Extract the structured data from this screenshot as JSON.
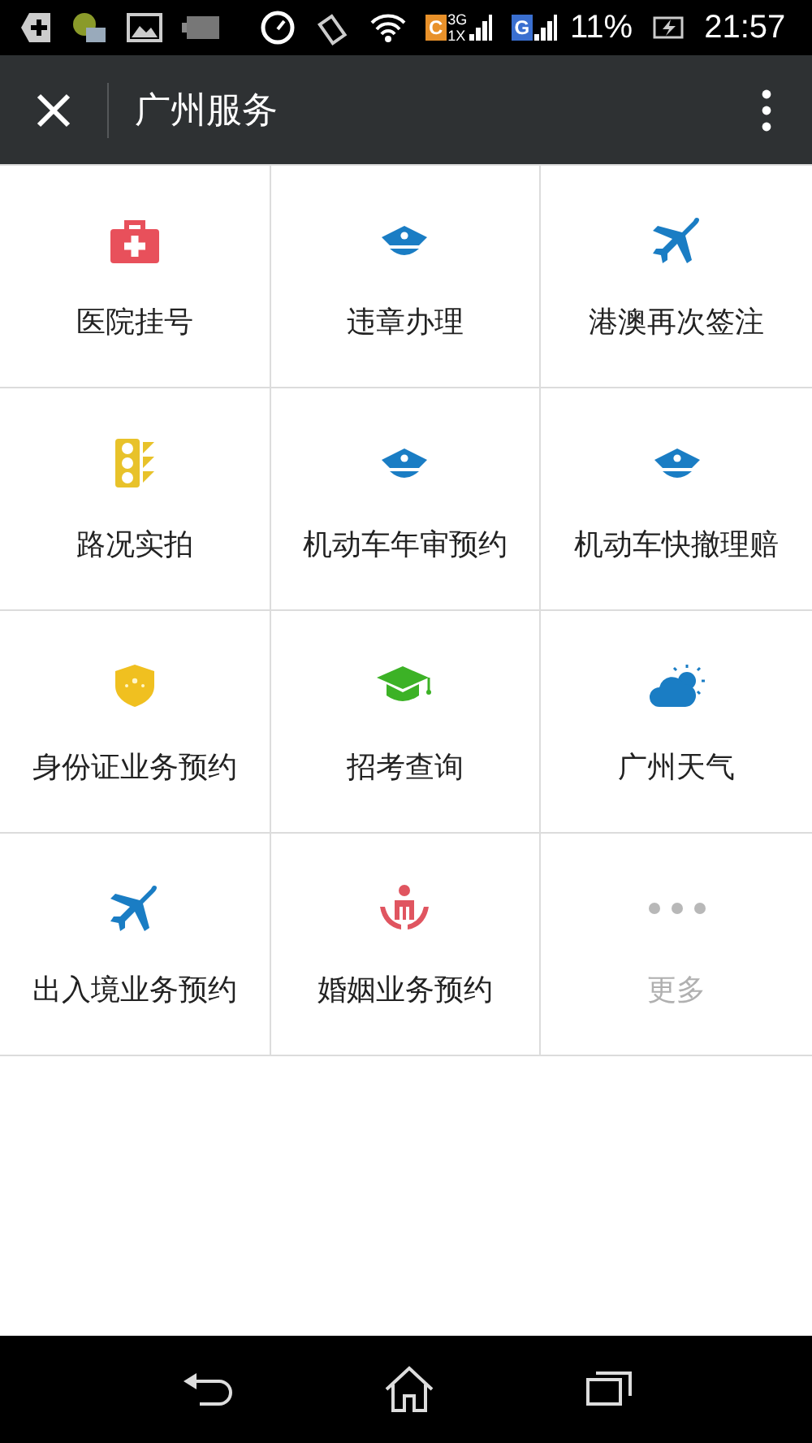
{
  "status_bar": {
    "carrier_badges": [
      "C",
      "G"
    ],
    "network_labels": [
      "3G",
      "1X"
    ],
    "battery": "11%",
    "time": "21:57"
  },
  "app_bar": {
    "title": "广州服务"
  },
  "services": [
    {
      "label": "医院挂号",
      "kind": "medkit",
      "disabled": false
    },
    {
      "label": "违章办理",
      "kind": "police",
      "disabled": false
    },
    {
      "label": "港澳再次签注",
      "kind": "plane",
      "disabled": false
    },
    {
      "label": "路况实拍",
      "kind": "traffic",
      "disabled": false
    },
    {
      "label": "机动车年审预约",
      "kind": "police",
      "disabled": false
    },
    {
      "label": "机动车快撤理赔",
      "kind": "police",
      "disabled": false
    },
    {
      "label": "身份证业务预约",
      "kind": "shield",
      "disabled": false
    },
    {
      "label": "招考查询",
      "kind": "graduation",
      "disabled": false
    },
    {
      "label": "广州天气",
      "kind": "weather",
      "disabled": false
    },
    {
      "label": "出入境业务预约",
      "kind": "plane",
      "disabled": false
    },
    {
      "label": "婚姻业务预约",
      "kind": "marriage",
      "disabled": false
    },
    {
      "label": "更多",
      "kind": "more",
      "disabled": true
    }
  ]
}
